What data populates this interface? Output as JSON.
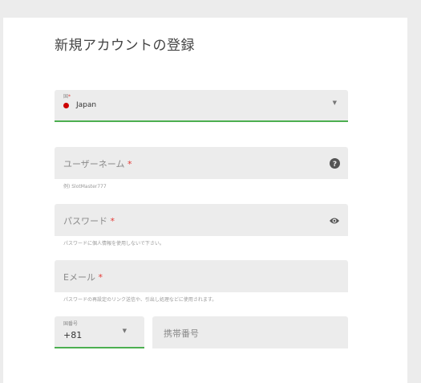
{
  "form": {
    "title": "新規アカウントの登録",
    "country": {
      "label": "国",
      "required_mark": "*",
      "value": "Japan",
      "flag_color": "#cc0000"
    },
    "username": {
      "placeholder": "ユーザーネーム",
      "required_mark": "*",
      "helper": "例) SlotMaster777",
      "icon": "help-icon"
    },
    "password": {
      "placeholder": "パスワード",
      "required_mark": "*",
      "helper": "パスワードに個人情報を使用しないで下さい。",
      "icon": "eye-icon"
    },
    "email": {
      "placeholder": "Eメール",
      "required_mark": "*",
      "helper": "パスワードの再設定のリンク送信や、引出し処理などに使用されます。"
    },
    "phone": {
      "code_label": "国番号",
      "code_value": "+81",
      "number_placeholder": "携帯番号"
    }
  },
  "colors": {
    "accent": "#4caf50",
    "required": "#e53935",
    "field_bg": "#ececec"
  }
}
